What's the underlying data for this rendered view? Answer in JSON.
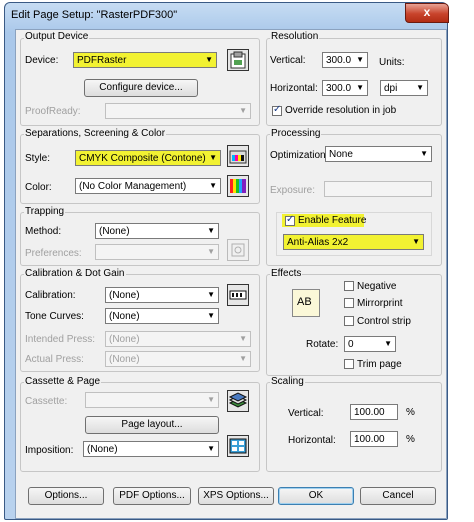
{
  "title": "Edit Page Setup: \"RasterPDF300\"",
  "close_glyph": "x",
  "output_device": {
    "legend": "Output Device",
    "device_label": "Device:",
    "device_value": "PDFRaster",
    "configure_btn": "Configure device...",
    "proofready_label": "ProofReady:",
    "proofready_value": ""
  },
  "separations": {
    "legend": "Separations, Screening & Color",
    "style_label": "Style:",
    "style_value": "CMYK Composite (Contone)",
    "color_label": "Color:",
    "color_value": "(No Color Management)"
  },
  "trapping": {
    "legend": "Trapping",
    "method_label": "Method:",
    "method_value": "(None)",
    "preferences_label": "Preferences:",
    "preferences_value": ""
  },
  "calibration": {
    "legend": "Calibration & Dot Gain",
    "calibration_label": "Calibration:",
    "calibration_value": "(None)",
    "tone_label": "Tone Curves:",
    "tone_value": "(None)",
    "intended_label": "Intended Press:",
    "intended_value": "(None)",
    "actual_label": "Actual Press:",
    "actual_value": "(None)"
  },
  "cassette": {
    "legend": "Cassette & Page",
    "cassette_label": "Cassette:",
    "cassette_value": "",
    "page_layout_btn": "Page layout...",
    "imposition_label": "Imposition:",
    "imposition_value": "(None)"
  },
  "resolution": {
    "legend": "Resolution",
    "vertical_label": "Vertical:",
    "vertical_value": "300.0",
    "units_label": "Units:",
    "horizontal_label": "Horizontal:",
    "horizontal_value": "300.0",
    "units_value": "dpi",
    "override_label": "Override resolution in job",
    "override_checked": true
  },
  "processing": {
    "legend": "Processing",
    "optimization_label": "Optimization:",
    "optimization_value": "None",
    "exposure_label": "Exposure:",
    "exposure_value": "",
    "enable_label": "Enable Feature",
    "enable_checked": true,
    "feature_value": "Anti-Alias 2x2"
  },
  "effects": {
    "legend": "Effects",
    "preview_text": "AB",
    "negative_label": "Negative",
    "mirrorprint_label": "Mirrorprint",
    "control_strip_label": "Control strip",
    "rotate_label": "Rotate:",
    "rotate_value": "0",
    "trim_label": "Trim page"
  },
  "scaling": {
    "legend": "Scaling",
    "vertical_label": "Vertical:",
    "vertical_value": "100.00",
    "horizontal_label": "Horizontal:",
    "horizontal_value": "100.00",
    "percent": "%"
  },
  "buttons": {
    "options": "Options...",
    "pdf_options": "PDF Options...",
    "xps_options": "XPS Options...",
    "ok": "OK",
    "cancel": "Cancel"
  },
  "colors": {
    "highlight": "#f2f232",
    "title_bar": "#aac8ea",
    "close": "#c8432b"
  }
}
